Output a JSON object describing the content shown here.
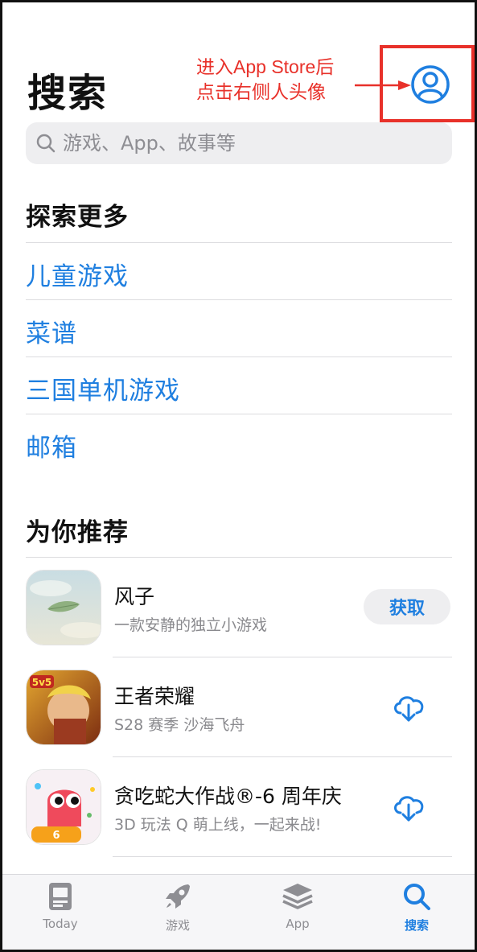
{
  "header": {
    "title": "搜索",
    "annotation_line1": "进入App Store后",
    "annotation_line2": "点击右侧人头像",
    "annotation_color": "#e8312a",
    "avatar_icon": "person-circle-icon"
  },
  "search": {
    "placeholder": "游戏、App、故事等",
    "icon": "search-icon"
  },
  "explore": {
    "title": "探索更多",
    "items": [
      "儿童游戏",
      "菜谱",
      "三国单机游戏",
      "邮箱"
    ]
  },
  "recommend": {
    "title": "为你推荐",
    "apps": [
      {
        "name": "风子",
        "subtitle": "一款安静的独立小游戏",
        "action": "获取"
      },
      {
        "name": "王者荣耀",
        "subtitle": "S28 赛季 沙海飞舟",
        "action_icon": "cloud-download-icon"
      },
      {
        "name": "贪吃蛇大作战®-6 周年庆",
        "subtitle": "3D 玩法 Q 萌上线，一起来战!",
        "action_icon": "cloud-download-icon"
      }
    ]
  },
  "tabbar": {
    "tabs": [
      {
        "label": "Today",
        "icon": "today-icon"
      },
      {
        "label": "游戏",
        "icon": "rocket-icon"
      },
      {
        "label": "App",
        "icon": "layers-icon"
      },
      {
        "label": "搜索",
        "icon": "search-icon",
        "active": true
      }
    ]
  },
  "colors": {
    "accent": "#1f7fe0",
    "annotation": "#e8312a"
  }
}
